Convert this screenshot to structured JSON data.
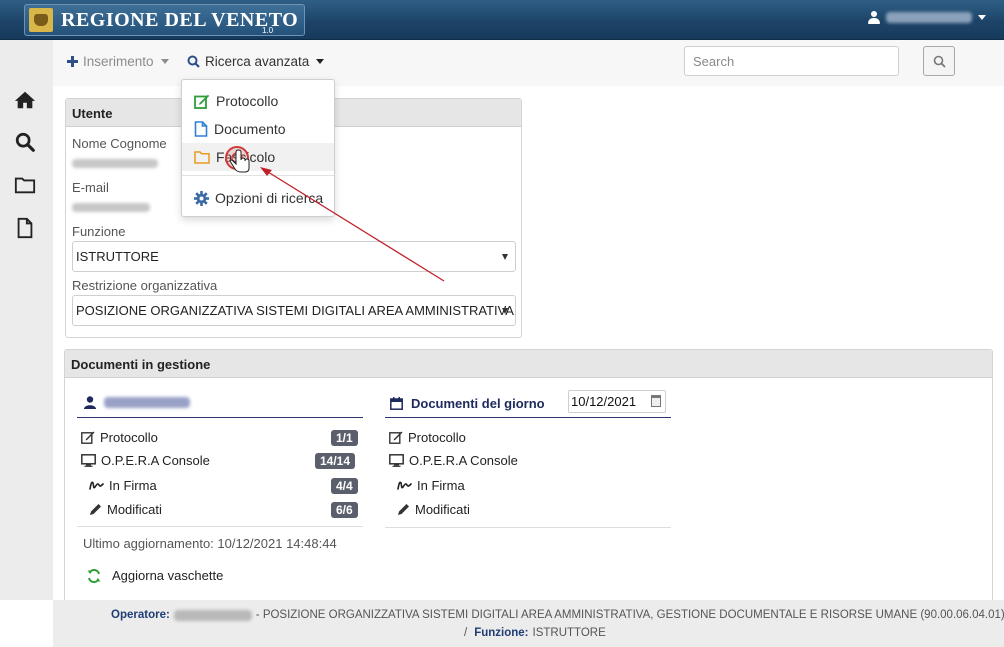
{
  "header": {
    "brand": "REGIONE DEL VENETO",
    "version": "1.0"
  },
  "toolbar": {
    "insert_label": "Inserimento",
    "advanced_search_label": "Ricerca avanzata",
    "search_placeholder": "Search"
  },
  "search_menu": {
    "items": [
      {
        "label": "Protocollo",
        "icon": "edit-icon",
        "color": "#2e9e3a"
      },
      {
        "label": "Documento",
        "icon": "file-icon",
        "color": "#2f7fd6"
      },
      {
        "label": "Fascicolo",
        "icon": "folder-icon",
        "color": "#e89a1f"
      },
      {
        "label": "Opzioni di ricerca",
        "icon": "gear-icon",
        "color": "#3b6aa6"
      }
    ]
  },
  "utente": {
    "title": "Utente",
    "name_label": "Nome Cognome",
    "email_label": "E-mail",
    "funzione_label": "Funzione",
    "funzione_value": "ISTRUTTORE",
    "restrizione_label": "Restrizione organizzativa",
    "restrizione_value": "POSIZIONE ORGANIZZATIVA SISTEMI DIGITALI AREA AMMINISTRATIVA, GESTIONE DOCUMENTALE E RISORSE UMANE"
  },
  "documenti": {
    "title": "Documenti in gestione",
    "left_rows": [
      {
        "label": "Protocollo",
        "icon": "edit-icon",
        "count": "1/1"
      },
      {
        "label": "O.P.E.R.A Console",
        "icon": "monitor-icon",
        "count": "14/14"
      },
      {
        "label": "In Firma",
        "icon": "signature-icon",
        "count": "4/4"
      },
      {
        "label": "Modificati",
        "icon": "pencil-icon",
        "count": "6/6"
      }
    ],
    "day_title": "Documenti del giorno",
    "day_date": "10/12/2021",
    "right_rows": [
      {
        "label": "Protocollo",
        "icon": "edit-icon"
      },
      {
        "label": "O.P.E.R.A Console",
        "icon": "monitor-icon"
      },
      {
        "label": "In Firma",
        "icon": "signature-icon"
      },
      {
        "label": "Modificati",
        "icon": "pencil-icon"
      }
    ],
    "last_update": "Ultimo aggiornamento: 10/12/2021 14:48:44",
    "refresh_label": "Aggiorna vaschette"
  },
  "footer": {
    "operatore_label": "Operatore:",
    "operatore_rest": "- POSIZIONE ORGANIZZATIVA SISTEMI DIGITALI AREA AMMINISTRATIVA, GESTIONE DOCUMENTALE E RISORSE UMANE (90.00.06.04.01)",
    "separator": "/",
    "funzione_label": "Funzione:",
    "funzione_value": "ISTRUTTORE"
  },
  "colors": {
    "header_bg": "#1d4468",
    "accent_navy": "#1f2a5c",
    "badge": "#5a5f6b",
    "annotation": "#c0202a"
  }
}
